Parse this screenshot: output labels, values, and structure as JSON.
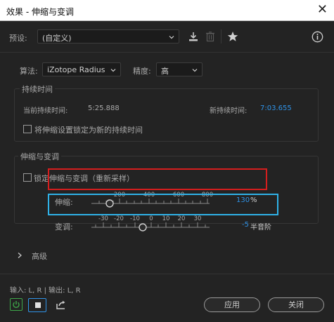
{
  "window": {
    "title": "效果 - 伸缩与变调",
    "close_glyph": "✕"
  },
  "preset": {
    "label": "预设:",
    "value": "(自定义)"
  },
  "algorithm": {
    "label": "算法:",
    "value": "iZotope Radius"
  },
  "precision": {
    "label": "精度:",
    "value": "高"
  },
  "duration": {
    "title": "持续时间",
    "current_label": "当前持续时间:",
    "current_value": "5:25.888",
    "new_label": "新持续时间:",
    "new_value": "7:03.655",
    "lock_label": "将伸缩设置锁定为新的持续时间"
  },
  "stretch_pitch": {
    "title": "伸缩与变调",
    "lock_label": "锁定伸缩与变调（重新采样）",
    "stretch": {
      "label": "伸缩:",
      "ticks": [
        "200",
        "400",
        "600",
        "800"
      ],
      "value": "130",
      "unit": "%"
    },
    "pitch": {
      "label": "变调:",
      "ticks": [
        "-30",
        "-20",
        "-10",
        "0",
        "10",
        "20",
        "30"
      ],
      "value": "-5",
      "unit": "半音阶"
    }
  },
  "advanced": {
    "label": "高级"
  },
  "io": {
    "label": "输入: L, R | 输出: L, R"
  },
  "buttons": {
    "apply": "应用",
    "close": "关闭"
  },
  "colors": {
    "accent_blue": "#2f93e8",
    "highlight_red": "#d51e1e",
    "highlight_cyan": "#2fb2e8",
    "power_green": "#3ea84a"
  },
  "icons": [
    "download-icon",
    "trash-icon",
    "star-icon",
    "info-icon",
    "chevron-down-icon",
    "chevron-right-icon",
    "power-icon",
    "stop-icon",
    "export-icon"
  ]
}
